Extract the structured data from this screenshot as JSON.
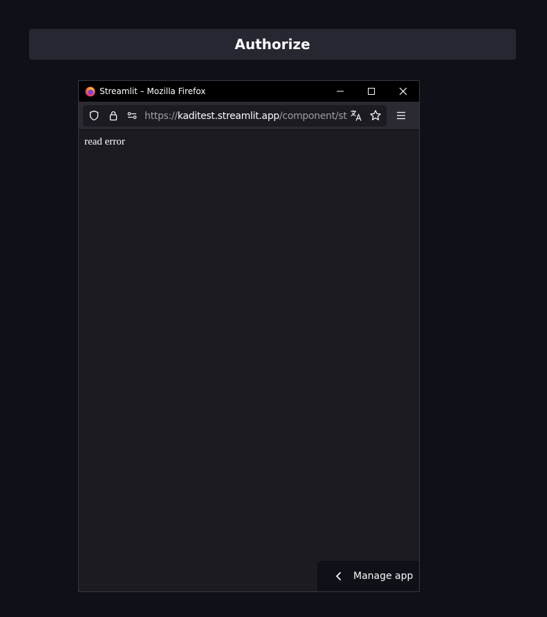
{
  "authorize": {
    "label": "Authorize"
  },
  "popup_window": {
    "title": "Streamlit – Mozilla Firefox",
    "url_prefix": "https://",
    "url_host": "kaditest.streamlit.app",
    "url_path": "/component/streamlit",
    "content_text": "read error",
    "icons": {
      "browser_logo": "firefox-logo",
      "minimize": "minimize-icon",
      "maximize": "maximize-icon",
      "close": "close-icon",
      "tracking": "shield-icon",
      "security": "lock-icon",
      "permissions": "permissions-icon",
      "translate": "translate-icon",
      "bookmark": "star-icon",
      "menu": "hamburger-menu-icon"
    }
  },
  "manage_app": {
    "label": "Manage app",
    "icon": "chevron-left-icon"
  },
  "colors": {
    "app_background": "#0e1117",
    "button_background": "#262730",
    "browser_chrome": "#2b2a33",
    "browser_content": "#1c1b22",
    "titlebar": "#000000",
    "text": "#fafafa"
  }
}
